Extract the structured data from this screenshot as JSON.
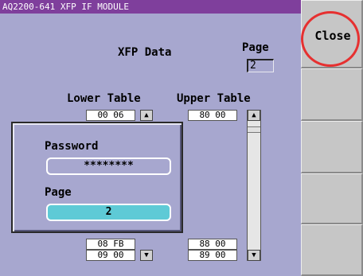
{
  "window": {
    "title": "AQ2200-641 XFP IF MODULE"
  },
  "header": {
    "title": "XFP Data",
    "page_label": "Page",
    "page_value": "2"
  },
  "tables": {
    "lower_label": "Lower Table",
    "upper_label": "Upper Table",
    "lower_top": [
      "00 06"
    ],
    "upper_top": [
      "80 00"
    ],
    "lower_bottom": [
      "08 FB",
      "09 00"
    ],
    "upper_bottom": [
      "88 00",
      "89 00"
    ]
  },
  "dialog": {
    "password_label": "Password",
    "password_value": "********",
    "page_label": "Page",
    "page_value": "2"
  },
  "sidebar": {
    "close_label": "Close"
  },
  "colors": {
    "title_bar": "#7f3f9c",
    "panel": "#a7a7cf",
    "highlight": "#5ecad6",
    "annotation": "#e63030"
  },
  "icons": {
    "scroll_up": "up-arrow-icon",
    "scroll_down": "down-arrow-icon"
  }
}
